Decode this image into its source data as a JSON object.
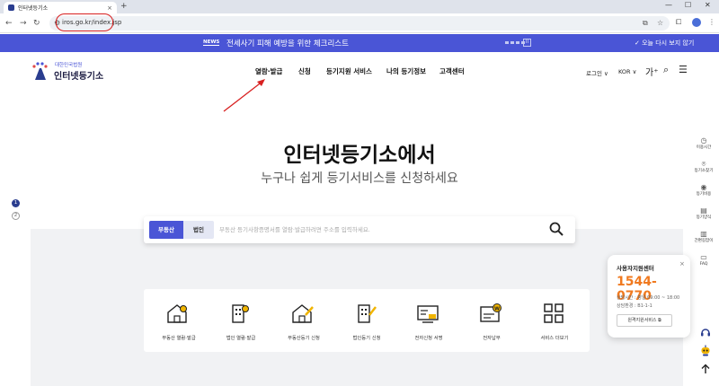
{
  "browser": {
    "tab_title": "인터넷등기소",
    "tab_close": "×",
    "new_tab": "+",
    "url": "iros.go.kr/index.jsp",
    "win_min": "—",
    "win_max": "☐",
    "win_close": "✕"
  },
  "notice": {
    "tag": "NEWS",
    "message": "전세사기 피해 예방을 위한 체크리스트",
    "pause": "II",
    "close_today": "✓ 오늘 다시 보지 않기"
  },
  "header": {
    "logo_sub": "대한민국법원",
    "logo_main": "인터넷등기소",
    "nav": [
      "열람·발급",
      "신청",
      "등기지원 서비스",
      "나의 등기정보",
      "고객센터"
    ],
    "login": "로그인 ∨",
    "lang": "KOR ∨",
    "font_size": "가⁺"
  },
  "hero": {
    "title": "인터넷등기소에서",
    "subtitle": "누구나 쉽게 등기서비스를 신청하세요"
  },
  "pager": [
    "1",
    "2"
  ],
  "search": {
    "tab_realestate": "부동산",
    "tab_corp": "법인",
    "placeholder": "부동산 등기사항증명서를 열람·발급하려면 주소를 입력하세요."
  },
  "cards": [
    "부동산 열람·발급",
    "법인 열람·발급",
    "부동산등기 신청",
    "법인등기 신청",
    "전자신청 서명",
    "전자납부",
    "서비스 더보기"
  ],
  "quick_menu": [
    "이용시간",
    "등기소찾기",
    "등기비용",
    "등기양식",
    "간편길잡이",
    "FAQ"
  ],
  "support": {
    "title": "사용자지원센터",
    "close": "×",
    "phone": "1544-0770",
    "hours": "상담시간 : 평일 09:00 ~ 18:00",
    "env": "상담환경 : B1-1-1",
    "remote": "원격지원서비스 ⧉"
  },
  "colors": {
    "brand": "#4a55d6",
    "navy": "#2a3d8f",
    "phone": "#f07a20",
    "annotation": "#d82020"
  }
}
